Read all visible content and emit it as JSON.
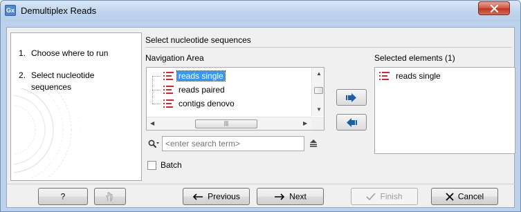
{
  "window": {
    "app_icon_text": "Gx",
    "title": "Demultiplex Reads"
  },
  "steps": [
    {
      "num": "1.",
      "label": "Choose where to run"
    },
    {
      "num": "2.",
      "label": "Select nucleotide sequences"
    }
  ],
  "main": {
    "heading": "Select nucleotide sequences",
    "navigation_label": "Navigation Area",
    "selected_label": "Selected elements (1)",
    "tree_items": [
      "reads single",
      "reads paired",
      "contigs denovo"
    ],
    "selected_index": 0,
    "selected_items": [
      "reads single"
    ],
    "search_placeholder": "<enter search term>",
    "batch_label": "Batch",
    "batch_checked": false
  },
  "buttons": {
    "help": "?",
    "previous": "Previous",
    "next": "Next",
    "finish": "Finish",
    "cancel": "Cancel"
  },
  "colors": {
    "selection": "#3399ff",
    "sequence_icon": "#d9242b",
    "arrow_icon": "#1c5fa8",
    "close_button": "#c9452f"
  },
  "icons": {
    "sequence": "sequence-list-icon",
    "add": "arrow-right-icon",
    "remove": "arrow-left-icon",
    "search": "magnifier-dropdown-icon",
    "search_options": "eject-options-icon",
    "reset": "hand-reset-icon"
  }
}
